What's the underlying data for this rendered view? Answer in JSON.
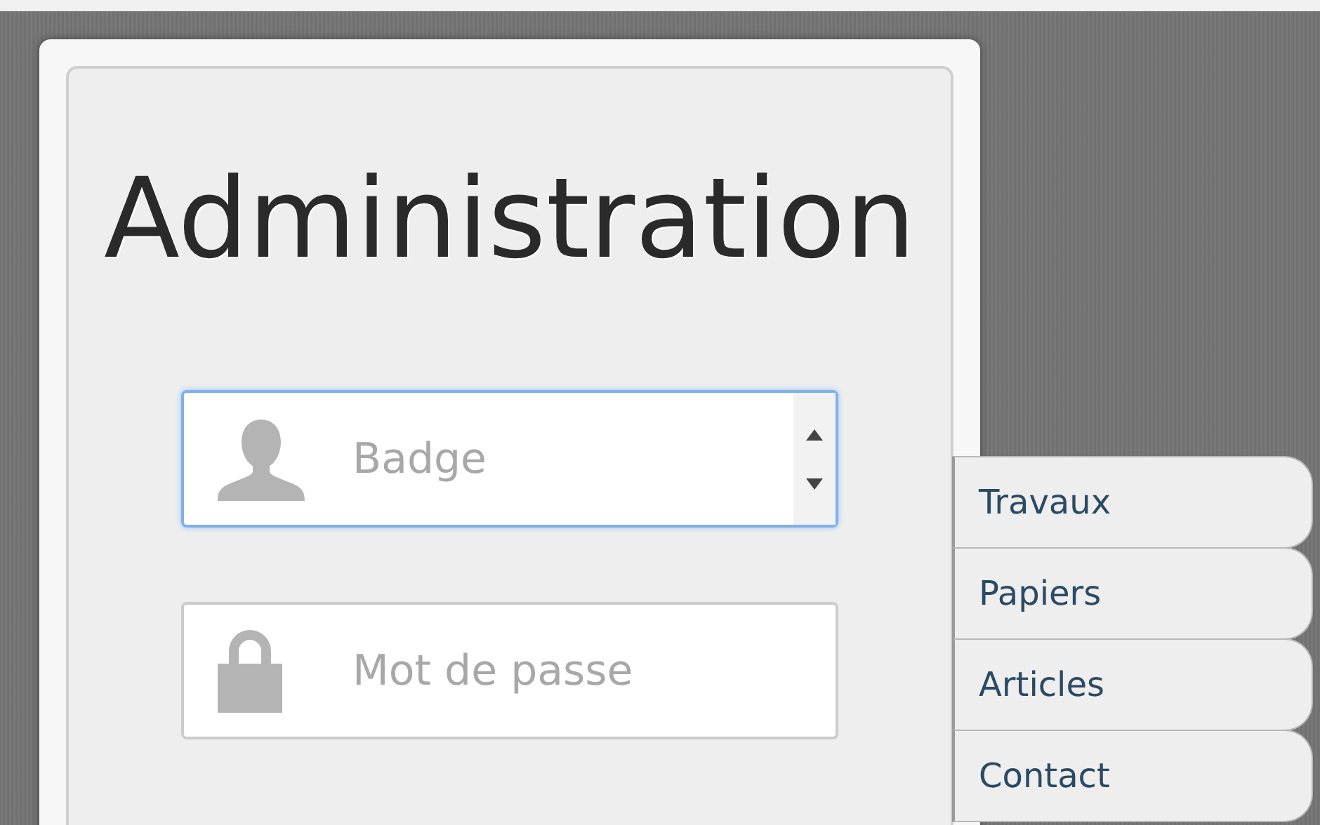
{
  "panel": {
    "title": "Administration"
  },
  "fields": [
    {
      "kind": "badge",
      "placeholder": "Badge",
      "focused": true
    },
    {
      "kind": "password",
      "placeholder": "Mot de passe",
      "focused": false
    }
  ],
  "menu": [
    "Travaux",
    "Papiers",
    "Articles",
    "Contact"
  ]
}
